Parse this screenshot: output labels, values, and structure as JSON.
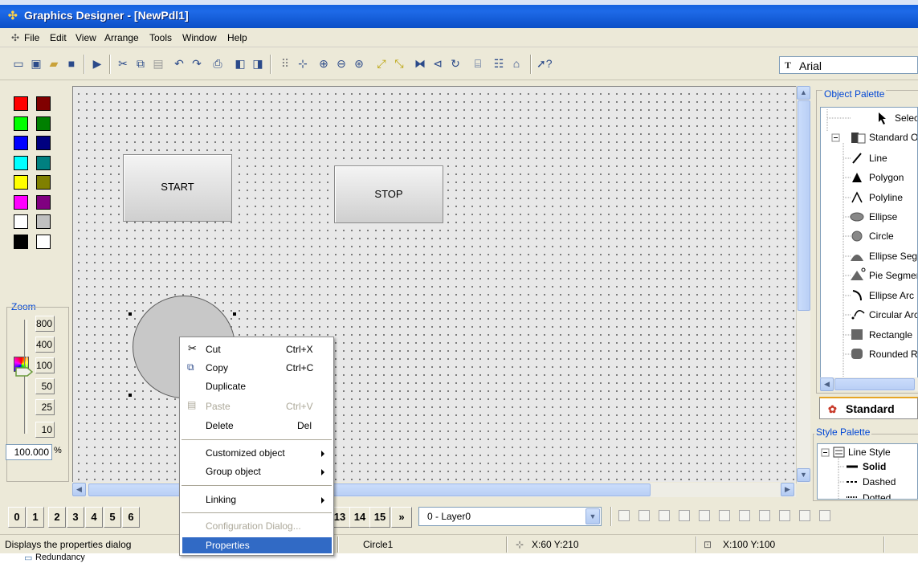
{
  "window": {
    "title": "Graphics Designer - [NewPdl1]"
  },
  "menu": [
    "File",
    "Edit",
    "View",
    "Arrange",
    "Tools",
    "Window",
    "Help"
  ],
  "toolbar": {
    "font_name": "Arial",
    "font_icon": "T"
  },
  "colors": {
    "swatches": [
      "#ff0000",
      "#800000",
      "#00ff00",
      "#008000",
      "#0000ff",
      "#000080",
      "#00ffff",
      "#008080",
      "#ffff00",
      "#808000",
      "#ff00ff",
      "#800080",
      "#ffffff",
      "#c0c0c0",
      "#000000",
      "#ffffff"
    ]
  },
  "zoom": {
    "label": "Zoom",
    "levels": [
      "800",
      "400",
      "100",
      "50",
      "25",
      "10"
    ],
    "value": "100.000",
    "unit": "%"
  },
  "canvas": {
    "start_label": "START",
    "stop_label": "STOP"
  },
  "context_menu": {
    "items": [
      {
        "label": "Cut",
        "shortcut": "Ctrl+X",
        "enabled": true
      },
      {
        "label": "Copy",
        "shortcut": "Ctrl+C",
        "enabled": true
      },
      {
        "label": "Duplicate",
        "shortcut": "",
        "enabled": true
      },
      {
        "label": "Paste",
        "shortcut": "Ctrl+V",
        "enabled": false
      },
      {
        "label": "Delete",
        "shortcut": "Del",
        "enabled": true
      },
      {
        "label": "Customized object",
        "shortcut": "",
        "enabled": true
      },
      {
        "label": "Group object",
        "shortcut": "",
        "enabled": true
      },
      {
        "label": "Linking",
        "shortcut": "",
        "enabled": true
      },
      {
        "label": "Configuration Dialog...",
        "shortcut": "",
        "enabled": false
      },
      {
        "label": "Properties",
        "shortcut": "",
        "enabled": true
      }
    ]
  },
  "layers": {
    "numbers": [
      "0",
      "1",
      "2",
      "3",
      "4",
      "5",
      "6"
    ],
    "numbers_right": [
      "13",
      "14",
      "15"
    ],
    "more": "»",
    "current": "0 - Layer0"
  },
  "status": {
    "hint": "Displays the properties dialog",
    "object": "Circle1",
    "position": "X:60 Y:210",
    "size": "X:100 Y:100"
  },
  "below": {
    "item": "Redundancy"
  },
  "object_palette": {
    "title": "Object Palette",
    "items": [
      "Selection",
      "Standard Objects",
      "Line",
      "Polygon",
      "Polyline",
      "Ellipse",
      "Circle",
      "Ellipse Segment",
      "Pie Segment",
      "Ellipse Arc",
      "Circular Arc",
      "Rectangle",
      "Rounded Rectangle"
    ],
    "tab": "Standard"
  },
  "style_palette": {
    "title": "Style Palette",
    "root": "Line Style",
    "items": [
      "Solid",
      "Dashed",
      "Dotted"
    ]
  }
}
